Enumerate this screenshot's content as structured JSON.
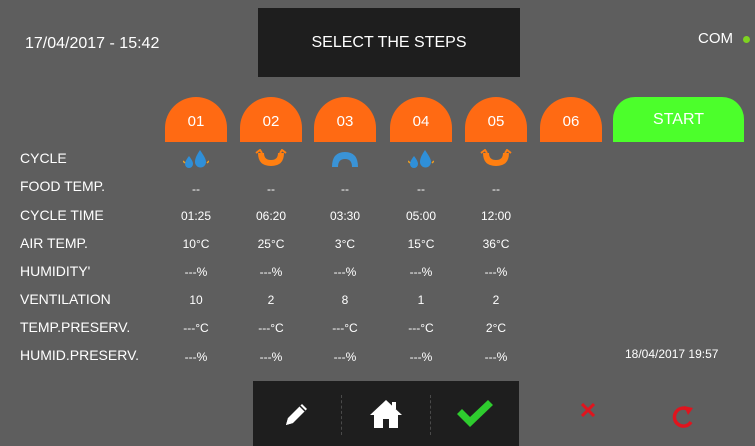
{
  "header": {
    "datetime": "17/04/2017 - 15:42",
    "title": "SELECT THE STEPS",
    "com_label": "COM"
  },
  "steps": [
    {
      "label": "01"
    },
    {
      "label": "02"
    },
    {
      "label": "03"
    },
    {
      "label": "04"
    },
    {
      "label": "05"
    },
    {
      "label": "06"
    }
  ],
  "start_label": "START",
  "rows": {
    "cycle": {
      "label": "CYCLE",
      "icons": [
        "water-drops-icon",
        "u-bowl-icon",
        "arc-icon",
        "water-drops-icon",
        "u-bowl-icon"
      ]
    },
    "food_temp": {
      "label": "FOOD TEMP.",
      "values": [
        "--",
        "--",
        "--",
        "--",
        "--"
      ]
    },
    "cycle_time": {
      "label": "CYCLE TIME",
      "values": [
        "01:25",
        "06:20",
        "03:30",
        "05:00",
        "12:00"
      ]
    },
    "air_temp": {
      "label": "AIR TEMP.",
      "values": [
        "10°C",
        "25°C",
        "3°C",
        "15°C",
        "36°C"
      ]
    },
    "humidity": {
      "label": "HUMIDITY'",
      "values": [
        "---%",
        "---%",
        "---%",
        "---%",
        "---%"
      ]
    },
    "ventilation": {
      "label": "VENTILATION",
      "values": [
        "10",
        "2",
        "8",
        "1",
        "2"
      ]
    },
    "temp_preserv": {
      "label": "TEMP.PRESERV.",
      "values": [
        "---°C",
        "---°C",
        "---°C",
        "---°C",
        "2°C"
      ]
    },
    "humid_preserv": {
      "label": "HUMID.PRESERV.",
      "values": [
        "---%",
        "---%",
        "---%",
        "---%",
        "---%"
      ]
    }
  },
  "preserv_datetime": "18/04/2017 19:57",
  "colors": {
    "background": "#5e5e5e",
    "step_orange": "#ff6a13",
    "start_green": "#4cff2b",
    "water_blue": "#2f8fd8",
    "bowl_orange": "#ff7f11",
    "arc_blue": "#3a93d6",
    "check_green": "#2ecc2e",
    "cancel_red": "#e0141e",
    "com_dot": "#7ed321"
  },
  "bottom_icons": [
    "pencil-icon",
    "home-icon",
    "checkmark-icon"
  ],
  "side_icons": [
    "cancel-icon",
    "reset-icon"
  ]
}
